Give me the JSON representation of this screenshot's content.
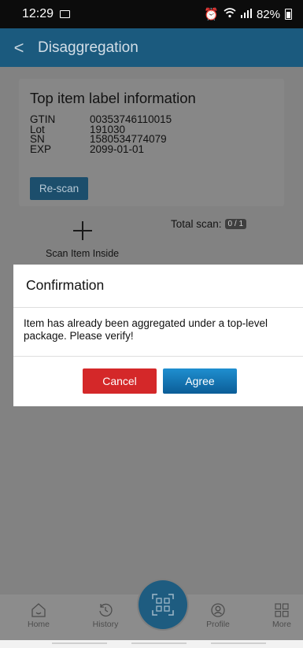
{
  "status": {
    "time": "12:29",
    "battery": "82%"
  },
  "header": {
    "back": "<",
    "title": "Disaggregation"
  },
  "card": {
    "title": "Top item label information",
    "fields": [
      {
        "key": "GTIN",
        "value": "00353746110015"
      },
      {
        "key": "Lot",
        "value": "191030"
      },
      {
        "key": "SN",
        "value": "1580534774079"
      },
      {
        "key": "EXP",
        "value": "2099-01-01"
      }
    ],
    "rescan_label": "Re-scan"
  },
  "scan": {
    "label": "Scan Item Inside",
    "total_label": "Total scan:",
    "count": "0 / 1"
  },
  "dialog": {
    "title": "Confirmation",
    "message": "Item has already been aggregated under a top-level package. Please verify!",
    "cancel_label": "Cancel",
    "agree_label": "Agree"
  },
  "nav": {
    "home": "Home",
    "history": "History",
    "profile": "Profile",
    "more": "More"
  },
  "icons": {
    "back": "chevron-left-icon",
    "home": "home-icon",
    "history": "history-icon",
    "scan": "qr-scan-icon",
    "profile": "profile-icon",
    "more": "grid-icon"
  },
  "colors": {
    "header": "#1b5a7e",
    "cancel": "#d42829",
    "agree": "#0b5d97"
  }
}
